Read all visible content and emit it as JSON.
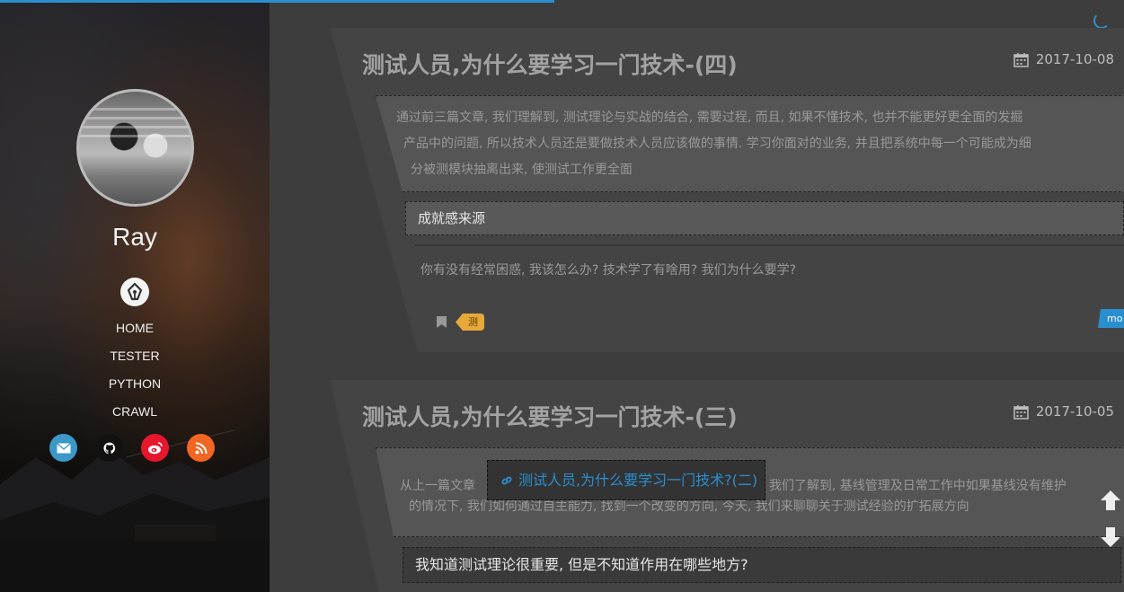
{
  "sidebar": {
    "site_name": "Ray",
    "nav": [
      "HOME",
      "TESTER",
      "PYTHON",
      "CRAWL"
    ],
    "socials": [
      {
        "icon": "mail-icon",
        "color": "#3b98c8"
      },
      {
        "icon": "github-icon",
        "color": "#111111"
      },
      {
        "icon": "weibo-icon",
        "color": "#e6162d"
      },
      {
        "icon": "rss-icon",
        "color": "#f26522"
      }
    ]
  },
  "posts": [
    {
      "title": "测试人员,为什么要学习一门技术-(四)",
      "date": "2017-10-08",
      "excerpt": [
        "通过前三篇文章, 我们理解到, 测试理论与实战的结合, 需要过程, 而且, 如果不懂技术, 也并不能更好更全面的发掘",
        "产品中的问题, 所以技术人员还是要做技术人员应该做的事情. 学习你面对的业务, 并且把系统中每一个可能成为细",
        "分被测模块抽离出来, 使测试工作更全面"
      ],
      "section_heading": "成就感来源",
      "sub_text": "你有没有经常困惑, 我该怎么办? 技术学了有啥用? 我们为什么要学?",
      "tag": "测试理论",
      "more_label": "mo"
    },
    {
      "title": "测试人员,为什么要学习一门技术-(三)",
      "date": "2017-10-05",
      "excerpt_prefix": "从上一篇文章",
      "excerpt_link": "测试人员,为什么要学习一门技术?(二)",
      "excerpt_suffix": "我们了解到, 基线管理及日常工作中如果基线没有维护",
      "excerpt_line2": "的情况下, 我们如何通过自主能力, 找到一个改变的方向, 今天, 我们来聊聊关于测试经验的扩拓展方向",
      "section_heading": "我知道测试理论很重要, 但是不知道作用在哪些地方?"
    }
  ],
  "colors": {
    "accent": "#2a8fd0",
    "tag": "#e6a93a"
  }
}
